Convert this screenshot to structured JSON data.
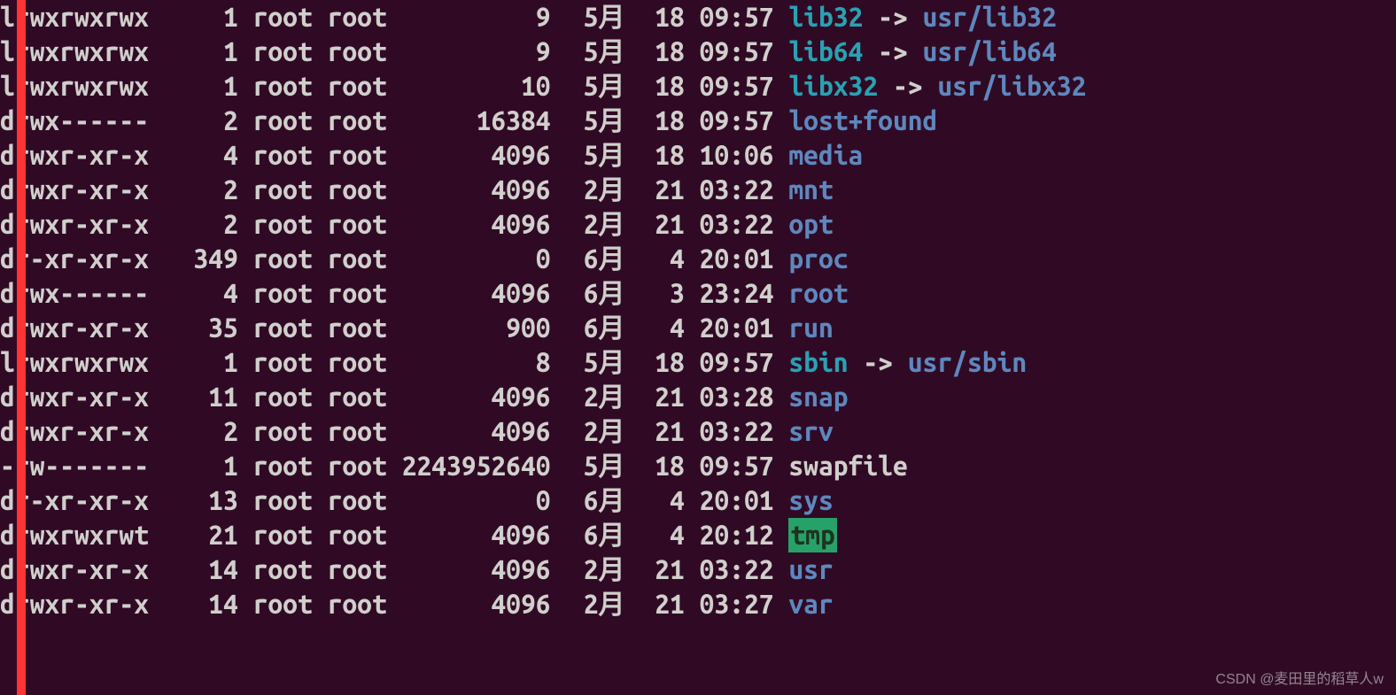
{
  "watermark": "CSDN @麦田里的稻草人w",
  "owner": "root",
  "group": "root",
  "rows": [
    {
      "perm": "lrwxrwxrwx",
      "links": "1",
      "size": "9",
      "mon": "5月",
      "day": "18",
      "time": "09:57",
      "name": "lib32",
      "cls": "c-sym",
      "arrow": "->",
      "target": "usr/lib32",
      "tcls": "c-tgt"
    },
    {
      "perm": "lrwxrwxrwx",
      "links": "1",
      "size": "9",
      "mon": "5月",
      "day": "18",
      "time": "09:57",
      "name": "lib64",
      "cls": "c-sym",
      "arrow": "->",
      "target": "usr/lib64",
      "tcls": "c-tgt"
    },
    {
      "perm": "lrwxrwxrwx",
      "links": "1",
      "size": "10",
      "mon": "5月",
      "day": "18",
      "time": "09:57",
      "name": "libx32",
      "cls": "c-sym",
      "arrow": "->",
      "target": "usr/libx32",
      "tcls": "c-tgt"
    },
    {
      "perm": "drwx------",
      "links": "2",
      "size": "16384",
      "mon": "5月",
      "day": "18",
      "time": "09:57",
      "name": "lost+found",
      "cls": "c-dir"
    },
    {
      "perm": "drwxr-xr-x",
      "links": "4",
      "size": "4096",
      "mon": "5月",
      "day": "18",
      "time": "10:06",
      "name": "media",
      "cls": "c-dir"
    },
    {
      "perm": "drwxr-xr-x",
      "links": "2",
      "size": "4096",
      "mon": "2月",
      "day": "21",
      "time": "03:22",
      "name": "mnt",
      "cls": "c-dir"
    },
    {
      "perm": "drwxr-xr-x",
      "links": "2",
      "size": "4096",
      "mon": "2月",
      "day": "21",
      "time": "03:22",
      "name": "opt",
      "cls": "c-dir"
    },
    {
      "perm": "dr-xr-xr-x",
      "links": "349",
      "size": "0",
      "mon": "6月",
      "day": "4",
      "time": "20:01",
      "name": "proc",
      "cls": "c-dir"
    },
    {
      "perm": "drwx------",
      "links": "4",
      "size": "4096",
      "mon": "6月",
      "day": "3",
      "time": "23:24",
      "name": "root",
      "cls": "c-dir"
    },
    {
      "perm": "drwxr-xr-x",
      "links": "35",
      "size": "900",
      "mon": "6月",
      "day": "4",
      "time": "20:01",
      "name": "run",
      "cls": "c-dir"
    },
    {
      "perm": "lrwxrwxrwx",
      "links": "1",
      "size": "8",
      "mon": "5月",
      "day": "18",
      "time": "09:57",
      "name": "sbin",
      "cls": "c-sym",
      "arrow": "->",
      "target": "usr/sbin",
      "tcls": "c-tgt"
    },
    {
      "perm": "drwxr-xr-x",
      "links": "11",
      "size": "4096",
      "mon": "2月",
      "day": "21",
      "time": "03:28",
      "name": "snap",
      "cls": "c-dir"
    },
    {
      "perm": "drwxr-xr-x",
      "links": "2",
      "size": "4096",
      "mon": "2月",
      "day": "21",
      "time": "03:22",
      "name": "srv",
      "cls": "c-dir"
    },
    {
      "perm": "-rw-------",
      "links": "1",
      "size": "2243952640",
      "mon": "5月",
      "day": "18",
      "time": "09:57",
      "name": "swapfile",
      "cls": "c-plain"
    },
    {
      "perm": "dr-xr-xr-x",
      "links": "13",
      "size": "0",
      "mon": "6月",
      "day": "4",
      "time": "20:01",
      "name": "sys",
      "cls": "c-dir"
    },
    {
      "perm": "drwxrwxrwt",
      "links": "21",
      "size": "4096",
      "mon": "6月",
      "day": "4",
      "time": "20:12",
      "name": "tmp",
      "cls": "c-sticky"
    },
    {
      "perm": "drwxr-xr-x",
      "links": "14",
      "size": "4096",
      "mon": "2月",
      "day": "21",
      "time": "03:22",
      "name": "usr",
      "cls": "c-dir"
    },
    {
      "perm": "drwxr-xr-x",
      "links": "14",
      "size": "4096",
      "mon": "2月",
      "day": "21",
      "time": "03:27",
      "name": "var",
      "cls": "c-dir"
    }
  ]
}
